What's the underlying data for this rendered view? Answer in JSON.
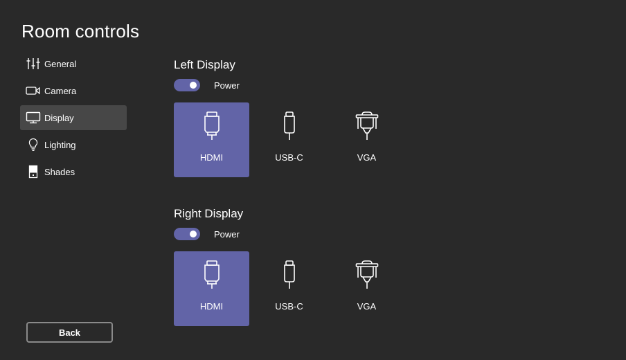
{
  "header": {
    "title": "Room controls"
  },
  "nav": {
    "items": [
      {
        "label": "General",
        "icon": "sliders-icon",
        "active": false
      },
      {
        "label": "Camera",
        "icon": "camera-icon",
        "active": false
      },
      {
        "label": "Display",
        "icon": "monitor-icon",
        "active": true
      },
      {
        "label": "Lighting",
        "icon": "lightbulb-icon",
        "active": false
      },
      {
        "label": "Shades",
        "icon": "shades-icon",
        "active": false
      }
    ]
  },
  "displays": [
    {
      "title": "Left Display",
      "power_label": "Power",
      "power_on": true,
      "inputs": [
        {
          "label": "HDMI",
          "icon": "hdmi-icon",
          "selected": true
        },
        {
          "label": "USB-C",
          "icon": "usb-c-icon",
          "selected": false
        },
        {
          "label": "VGA",
          "icon": "vga-icon",
          "selected": false
        }
      ]
    },
    {
      "title": "Right Display",
      "power_label": "Power",
      "power_on": true,
      "inputs": [
        {
          "label": "HDMI",
          "icon": "hdmi-icon",
          "selected": true
        },
        {
          "label": "USB-C",
          "icon": "usb-c-icon",
          "selected": false
        },
        {
          "label": "VGA",
          "icon": "vga-icon",
          "selected": false
        }
      ]
    }
  ],
  "footer": {
    "back_label": "Back"
  },
  "colors": {
    "background": "#292929",
    "accent": "#6264a7",
    "nav_active": "#474747"
  }
}
